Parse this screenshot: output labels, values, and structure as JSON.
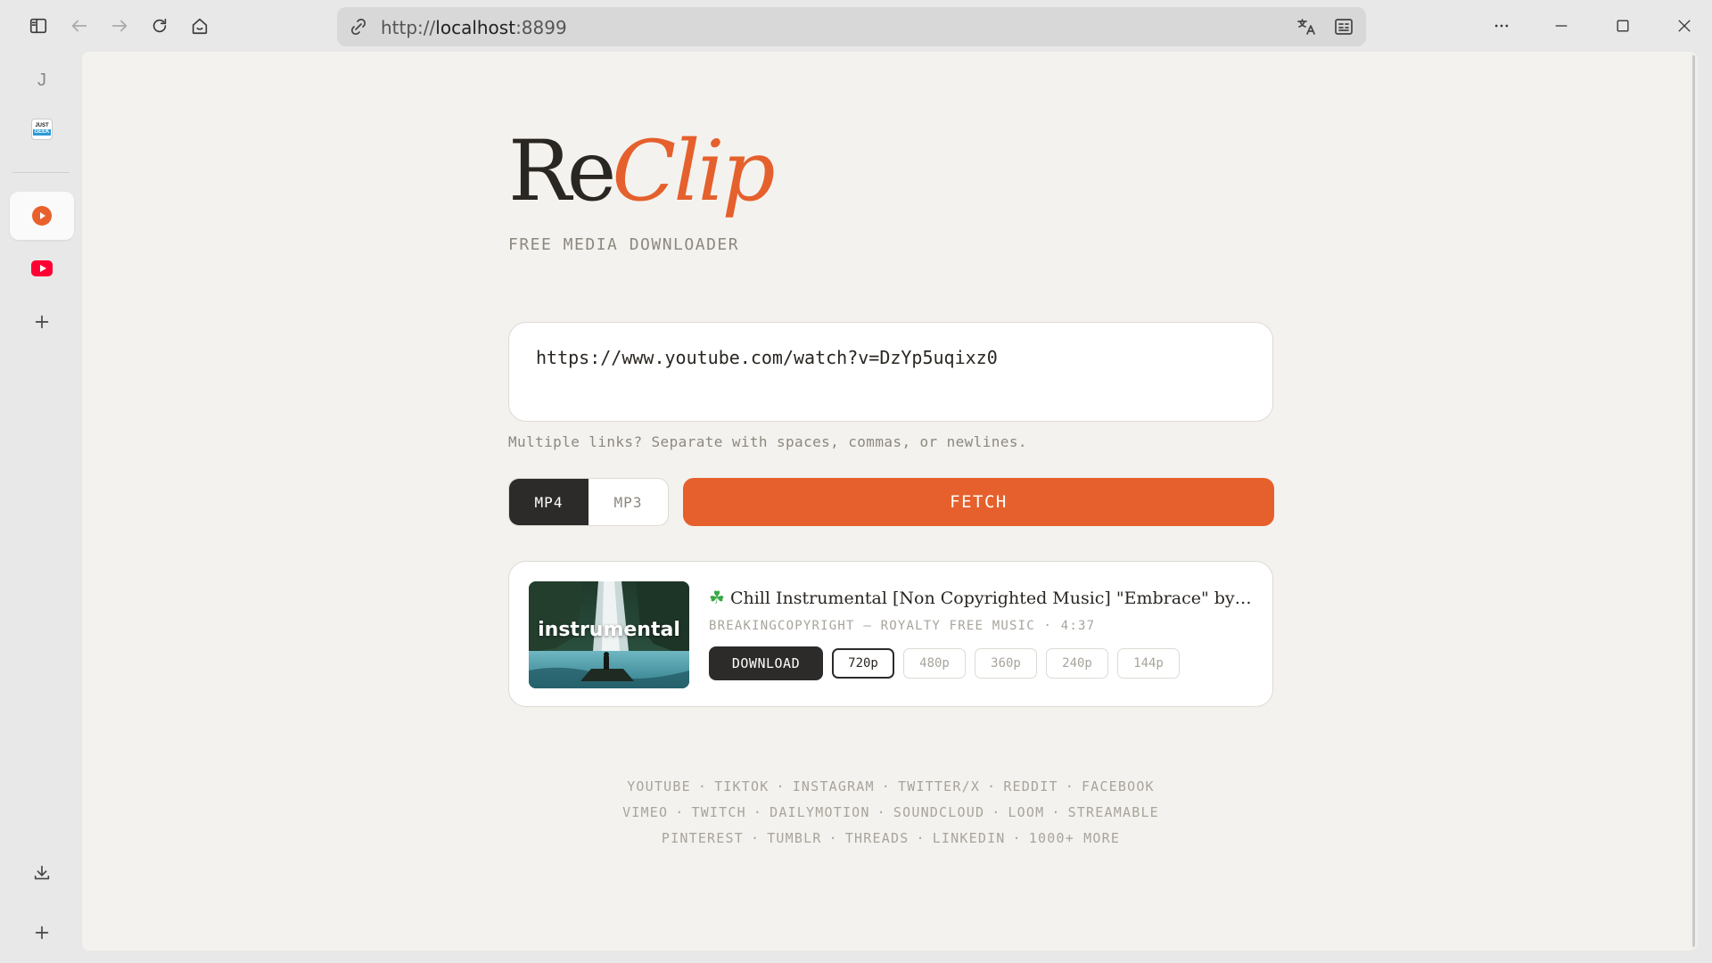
{
  "browser": {
    "url_scheme": "http://",
    "url_host": "localhost",
    "url_port": ":8899"
  },
  "sidebar": {
    "items": [
      {
        "label": "J",
        "icon": "profile-letter-icon"
      },
      {
        "icon": "just-geek-icon",
        "line1": "JUST",
        "line2": "GEEK"
      },
      {
        "icon": "reclip-app-icon",
        "active": true
      },
      {
        "icon": "youtube-icon"
      },
      {
        "icon": "plus-icon"
      }
    ]
  },
  "page": {
    "logo_part1": "Re",
    "logo_part2": "Clip",
    "tagline": "FREE MEDIA DOWNLOADER",
    "url_input_value": "https://www.youtube.com/watch?v=DzYp5uqixz0",
    "hint": "Multiple links? Separate with spaces, commas, or newlines.",
    "formats": [
      {
        "label": "MP4",
        "selected": true
      },
      {
        "label": "MP3",
        "selected": false
      }
    ],
    "fetch_label": "FETCH",
    "result": {
      "thumbnail_text": "instrumental",
      "title": "Chill Instrumental [Non Copyrighted Music] \"Embrace\" by @Sapphe...",
      "channel": "BREAKINGCOPYRIGHT — ROYALTY FREE MUSIC",
      "duration": "4:37",
      "download_label": "DOWNLOAD",
      "qualities": [
        {
          "label": "720p",
          "selected": true
        },
        {
          "label": "480p",
          "selected": false
        },
        {
          "label": "360p",
          "selected": false
        },
        {
          "label": "240p",
          "selected": false
        },
        {
          "label": "144p",
          "selected": false
        }
      ]
    },
    "platform_rows": [
      [
        "YOUTUBE",
        "TIKTOK",
        "INSTAGRAM",
        "TWITTER/X",
        "REDDIT",
        "FACEBOOK"
      ],
      [
        "VIMEO",
        "TWITCH",
        "DAILYMOTION",
        "SOUNDCLOUD",
        "LOOM",
        "STREAMABLE"
      ],
      [
        "PINTEREST",
        "TUMBLR",
        "THREADS",
        "LINKEDIN",
        "1000+ MORE"
      ]
    ]
  },
  "colors": {
    "accent": "#e5602c",
    "dark": "#2d2b29",
    "page_bg": "#f4f2ee"
  }
}
